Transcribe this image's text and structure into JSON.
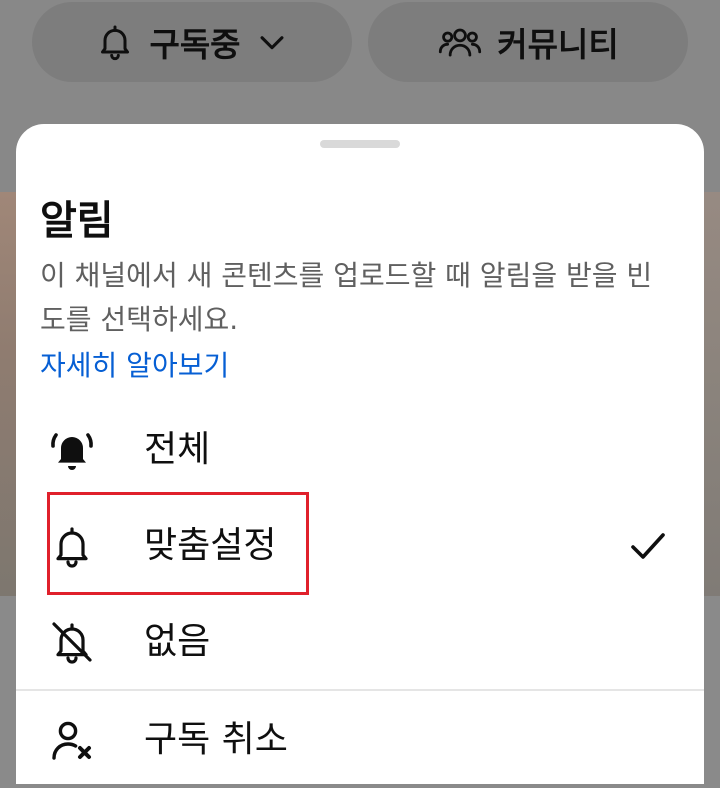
{
  "header": {
    "subscribed_label": "구독중",
    "community_label": "커뮤니티"
  },
  "sheet": {
    "title": "알림",
    "description": "이 채널에서 새 콘텐츠를 업로드할 때 알림을 받을 빈도를 선택하세요.",
    "learn_more": "자세히 알아보기",
    "options": [
      {
        "label": "전체",
        "icon": "bell-ringing-filled-icon",
        "selected": false
      },
      {
        "label": "맞춤설정",
        "icon": "bell-outline-icon",
        "selected": true
      },
      {
        "label": "없음",
        "icon": "bell-off-icon",
        "selected": false
      }
    ],
    "unsubscribe_label": "구독 취소",
    "unsubscribe_icon": "person-remove-icon"
  },
  "colors": {
    "link": "#065fd4",
    "highlight": "#e0202b",
    "text_primary": "#0f0f0f",
    "text_secondary": "#606060"
  }
}
